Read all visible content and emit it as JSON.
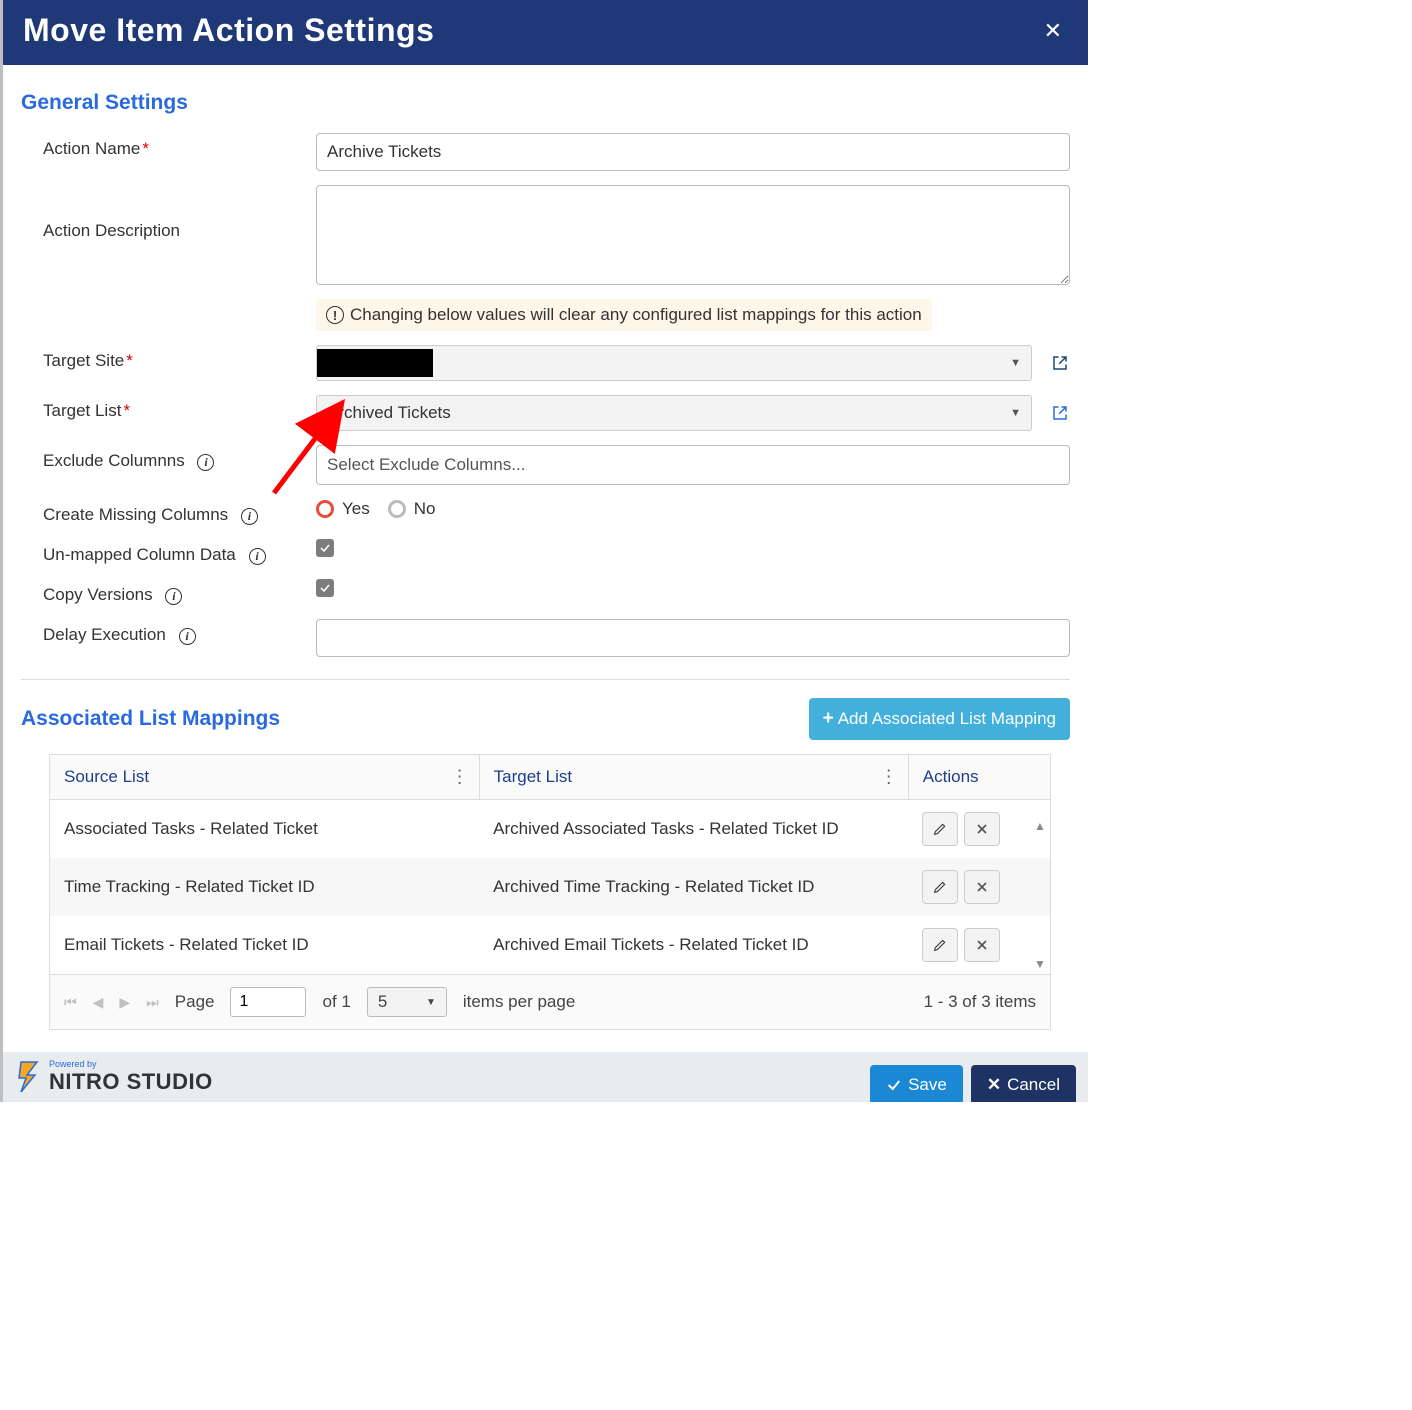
{
  "modal": {
    "title": "Move Item Action Settings"
  },
  "sections": {
    "general": "General Settings",
    "associated": "Associated List Mappings"
  },
  "labels": {
    "action_name": "Action Name",
    "action_description": "Action Description",
    "target_site": "Target Site",
    "target_list": "Target List",
    "exclude_columns": "Exclude Columnns",
    "create_missing": "Create Missing Columns",
    "unmapped": "Un-mapped Column Data",
    "copy_versions": "Copy Versions",
    "delay_execution": "Delay Execution"
  },
  "values": {
    "action_name": "Archive Tickets",
    "action_description": "",
    "target_site": "",
    "target_list": "Archived Tickets",
    "exclude_columns_placeholder": "Select Exclude Columns...",
    "delay_execution": ""
  },
  "warning": "Changing below values will clear any configured list mappings for this action",
  "radios": {
    "yes": "Yes",
    "no": "No",
    "create_missing_value": "Yes"
  },
  "checkboxes": {
    "unmapped": true,
    "copy_versions": true
  },
  "associated": {
    "add_button": "Add Associated List Mapping",
    "columns": {
      "source": "Source List",
      "target": "Target List",
      "actions": "Actions"
    },
    "rows": [
      {
        "source": "Associated Tasks - Related Ticket",
        "target": "Archived Associated Tasks - Related Ticket ID"
      },
      {
        "source": "Time Tracking - Related Ticket ID",
        "target": "Archived Time Tracking - Related Ticket ID"
      },
      {
        "source": "Email Tickets - Related Ticket ID",
        "target": "Archived Email Tickets - Related Ticket ID"
      }
    ],
    "pager": {
      "page_label": "Page",
      "page": "1",
      "of": "of 1",
      "page_size": "5",
      "per_page": "items per page",
      "summary": "1 - 3 of 3 items"
    }
  },
  "footer": {
    "powered_by": "Powered by",
    "brand1": "NITRO",
    "brand2": " STUDIO",
    "save": "Save",
    "cancel": "Cancel"
  }
}
